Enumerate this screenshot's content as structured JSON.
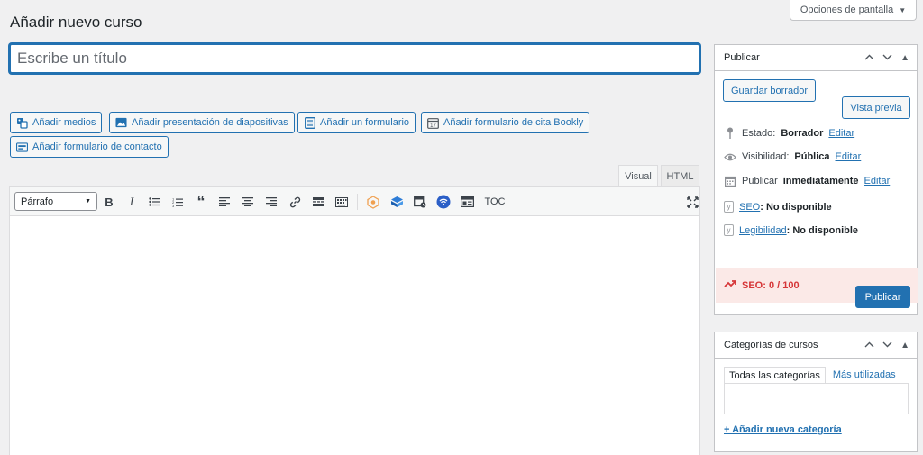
{
  "header": {
    "screen_options": "Opciones de pantalla",
    "page_title": "Añadir nuevo curso"
  },
  "title_field": {
    "placeholder": "Escribe un título",
    "value": ""
  },
  "media_buttons": [
    {
      "label": "Añadir medios",
      "icon": "add-media-icon"
    },
    {
      "label": "Añadir presentación de diapositivas",
      "icon": "slideshow-icon"
    },
    {
      "label": "Añadir un formulario",
      "icon": "form-icon"
    },
    {
      "label": "Añadir formulario de cita Bookly",
      "icon": "calendar-icon"
    },
    {
      "label": "Añadir formulario de contacto",
      "icon": "contact-form-icon"
    }
  ],
  "editor": {
    "tabs": {
      "visual": "Visual",
      "html": "HTML"
    },
    "format_select": "Párrafo",
    "toc_label": "TOC"
  },
  "publish_box": {
    "title": "Publicar",
    "save_draft": "Guardar borrador",
    "preview": "Vista previa",
    "status_label": "Estado:",
    "status_value": "Borrador",
    "visibility_label": "Visibilidad:",
    "visibility_value": "Pública",
    "schedule_label": "Publicar",
    "schedule_value": "inmediatamente",
    "edit_link": "Editar",
    "seo_link": "SEO",
    "seo_value": ": No disponible",
    "readability_link": "Legibilidad",
    "readability_value": ": No disponible",
    "seo_score": "SEO: 0 / 100",
    "publish_button": "Publicar"
  },
  "categories_box": {
    "title": "Categorías de cursos",
    "tab_all": "Todas las categorías",
    "tab_popular": "Más utilizadas",
    "add_new": "+ Añadir nueva categoría"
  },
  "colors": {
    "accent": "#2271b1",
    "seo_bad": "#d63638",
    "seo_bg": "#fbe9e7"
  }
}
